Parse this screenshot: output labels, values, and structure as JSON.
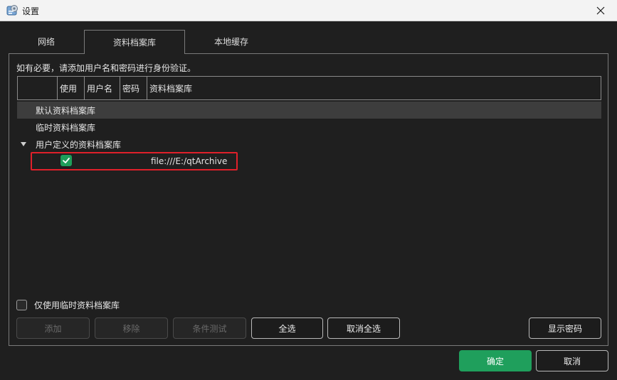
{
  "window": {
    "title": "设置",
    "app_icon": "settings-app-icon",
    "close_icon": "close-icon"
  },
  "tabs": [
    {
      "label": "网络",
      "active": false
    },
    {
      "label": "资料档案库",
      "active": true
    },
    {
      "label": "本地缓存",
      "active": false
    }
  ],
  "panel": {
    "hint": "如有必要，请添加用户名和密码进行身份验证。",
    "table": {
      "columns": [
        "",
        "使用",
        "用户名",
        "密码",
        "资料档案库"
      ],
      "rows": [
        {
          "label": "默认资料档案库",
          "selected": true
        },
        {
          "label": "临时资料档案库",
          "selected": false
        },
        {
          "label": "用户定义的资料档案库",
          "expanded": true
        },
        {
          "use_checked": true,
          "username": "",
          "password": "",
          "repository": "file:///E:/qtArchive"
        }
      ]
    },
    "temp_only_checkbox": {
      "label": "仅使用临时资料档案库",
      "checked": false
    },
    "buttons": {
      "add": "添加",
      "remove": "移除",
      "condition_test": "条件测试",
      "select_all": "全选",
      "deselect_all": "取消全选",
      "show_password": "显示密码"
    }
  },
  "footer": {
    "ok": "确定",
    "cancel": "取消"
  },
  "colors": {
    "background": "#1f1f1f",
    "accent_green": "#1f9f5c",
    "highlight_red": "#e0202a",
    "selected_row": "#3d3d3d"
  }
}
